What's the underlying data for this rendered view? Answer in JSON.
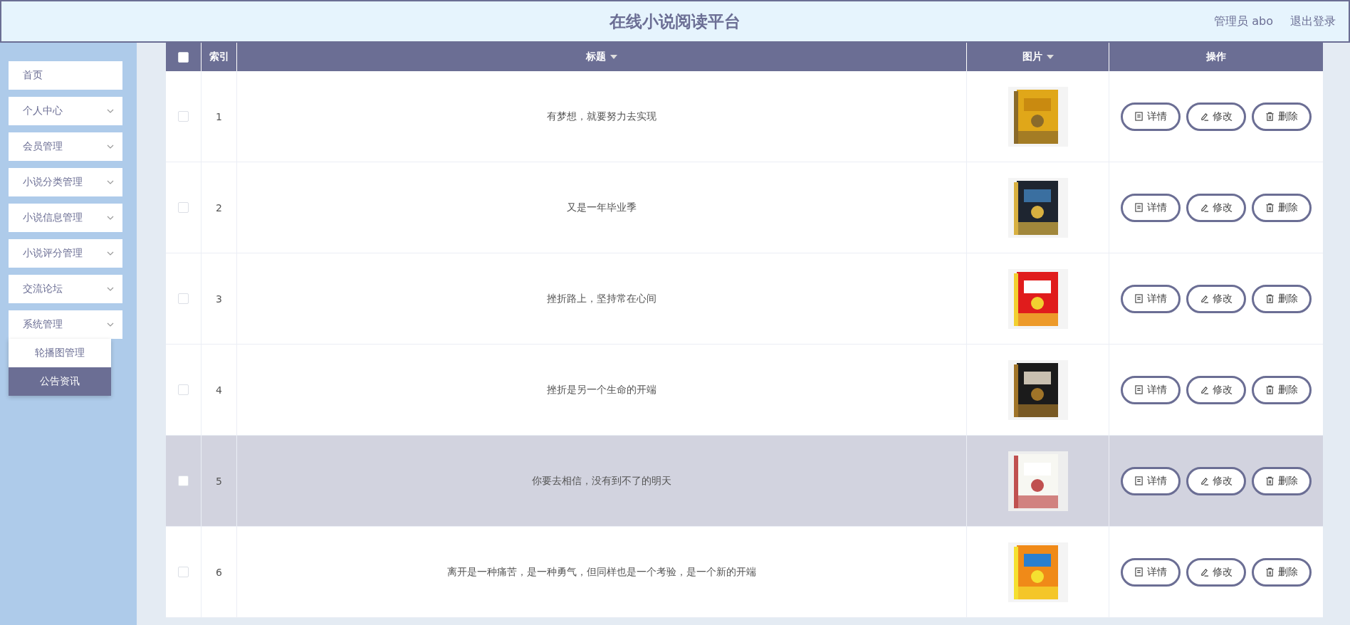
{
  "header": {
    "title": "在线小说阅读平台",
    "user": "管理员 abo",
    "logout": "退出登录"
  },
  "sidebar": {
    "items": [
      {
        "label": "首页",
        "expandable": false
      },
      {
        "label": "个人中心",
        "expandable": true,
        "expanded": false
      },
      {
        "label": "会员管理",
        "expandable": true,
        "expanded": false
      },
      {
        "label": "小说分类管理",
        "expandable": true,
        "expanded": false
      },
      {
        "label": "小说信息管理",
        "expandable": true,
        "expanded": false
      },
      {
        "label": "小说评分管理",
        "expandable": true,
        "expanded": false
      },
      {
        "label": "交流论坛",
        "expandable": true,
        "expanded": false
      },
      {
        "label": "系统管理",
        "expandable": true,
        "expanded": true,
        "children": [
          {
            "label": "轮播图管理",
            "selected": false
          },
          {
            "label": "公告资讯",
            "selected": true
          }
        ]
      }
    ]
  },
  "table": {
    "select_all": {
      "checked": false
    },
    "columns": [
      {
        "label": "索引",
        "sortable": false
      },
      {
        "label": "标题",
        "sortable": true
      },
      {
        "label": "图片",
        "sortable": true
      },
      {
        "label": "操作",
        "sortable": false
      }
    ],
    "rows": [
      {
        "index": "1",
        "title": "有梦想，就要努力去实现",
        "image": {
          "kind": "picture"
        },
        "checked": false,
        "selected": false,
        "actions": [
          {
            "kind": "detail",
            "label": "详情"
          },
          {
            "kind": "edit",
            "label": "修改"
          },
          {
            "kind": "delete",
            "label": "删除"
          }
        ]
      },
      {
        "index": "2",
        "title": "又是一年毕业季",
        "image": {
          "kind": "picture"
        },
        "checked": false,
        "selected": false,
        "actions": [
          {
            "kind": "detail",
            "label": "详情"
          },
          {
            "kind": "edit",
            "label": "修改"
          },
          {
            "kind": "delete",
            "label": "删除"
          }
        ]
      },
      {
        "index": "3",
        "title": "挫折路上，坚持常在心间",
        "image": {
          "kind": "picture"
        },
        "checked": false,
        "selected": false,
        "actions": [
          {
            "kind": "detail",
            "label": "详情"
          },
          {
            "kind": "edit",
            "label": "修改"
          },
          {
            "kind": "delete",
            "label": "删除"
          }
        ]
      },
      {
        "index": "4",
        "title": "挫折是另一个生命的开端",
        "image": {
          "kind": "picture"
        },
        "checked": false,
        "selected": false,
        "actions": [
          {
            "kind": "detail",
            "label": "详情"
          },
          {
            "kind": "edit",
            "label": "修改"
          },
          {
            "kind": "delete",
            "label": "删除"
          }
        ]
      },
      {
        "index": "5",
        "title": "你要去相信，没有到不了的明天",
        "image": {
          "kind": "picture"
        },
        "checked": false,
        "selected": true,
        "actions": [
          {
            "kind": "detail",
            "label": "详情"
          },
          {
            "kind": "edit",
            "label": "修改"
          },
          {
            "kind": "delete",
            "label": "删除"
          }
        ]
      },
      {
        "index": "6",
        "title": "离开是一种痛苦，是一种勇气，但同样也是一个考验，是一个新的开端",
        "image": {
          "kind": "picture"
        },
        "checked": false,
        "selected": false,
        "actions": [
          {
            "kind": "detail",
            "label": "详情"
          },
          {
            "kind": "edit",
            "label": "修改"
          },
          {
            "kind": "delete",
            "label": "删除"
          }
        ]
      }
    ]
  }
}
